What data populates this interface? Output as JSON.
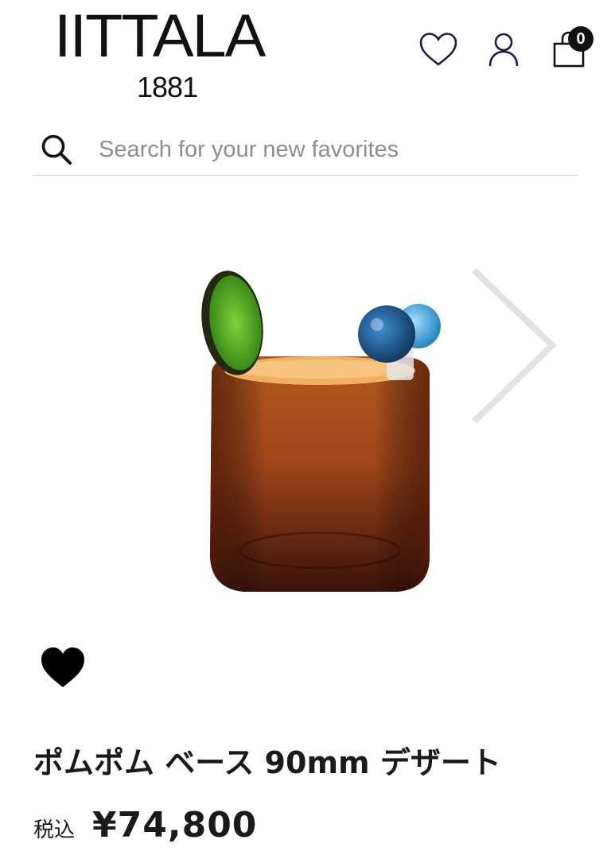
{
  "header": {
    "brand": "IITTALA",
    "year": "1881",
    "icons": [
      "heart-outline-icon",
      "user-icon",
      "shopping-bag-icon"
    ],
    "cart_count": "0"
  },
  "search": {
    "placeholder": "Search for your new favorites",
    "icon": "search-icon"
  },
  "product": {
    "name": "ポムポム ベース 90mm デザート",
    "tax_label": "税込",
    "price": "¥74,800",
    "wishlist_icon": "heart-filled-icon",
    "gallery_next_icon": "chevron-right-icon",
    "colors": {
      "glass": "#8a3a12",
      "leaf": "#5fb82a",
      "ball_dark": "#1f5e96",
      "ball_light": "#52b2e0"
    }
  }
}
